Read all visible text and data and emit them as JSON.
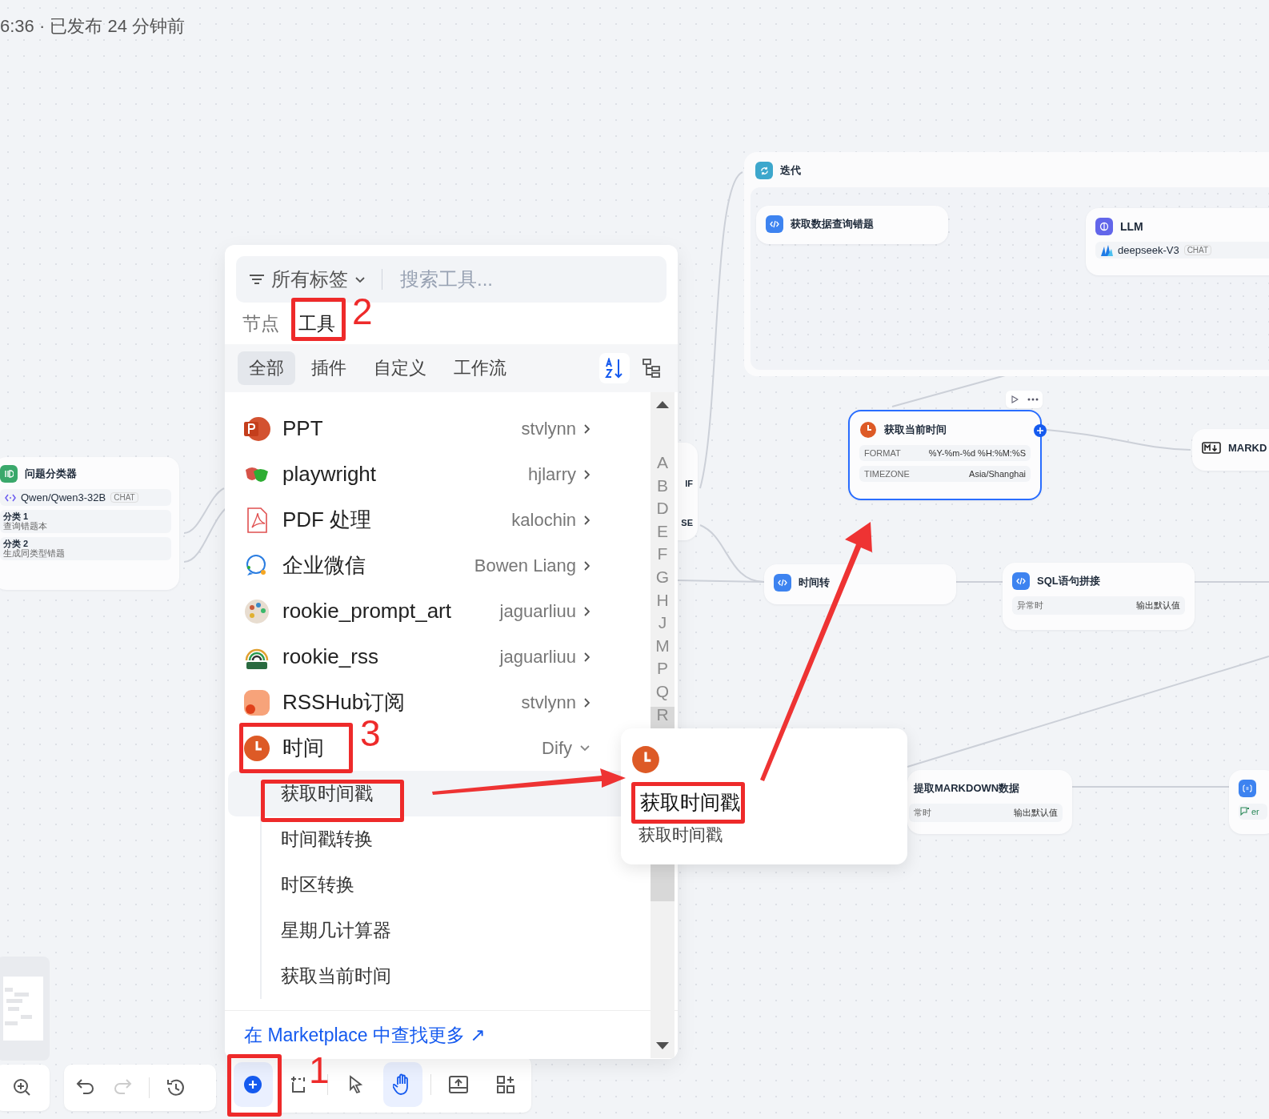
{
  "header": {
    "text": "6:36 · 已发布 24 分钟前"
  },
  "classifier": {
    "title": "问题分类器",
    "model": "Qwen/Qwen3-32B",
    "tag": "CHAT",
    "classes": [
      {
        "label": "分类 1",
        "text": "查询错题本"
      },
      {
        "label": "分类 2",
        "text": "生成同类型错题"
      }
    ]
  },
  "iteration": {
    "title": "迭代",
    "inner": {
      "title": "获取数据查询错题"
    },
    "llm": {
      "title": "LLM",
      "model": "deepseek-V3",
      "tag": "CHAT"
    }
  },
  "if_node": {
    "branches": [
      "IF",
      "SE"
    ]
  },
  "time_node": {
    "title": "获取当前时间",
    "selected": true,
    "params": [
      {
        "key": "FORMAT",
        "value": "%Y-%m-%d %H:%M:%S"
      },
      {
        "key": "TIMEZONE",
        "value": "Asia/Shanghai"
      }
    ]
  },
  "markdown_node": {
    "title": "MARKD"
  },
  "convert_node": {
    "title": "时间转"
  },
  "sql_node": {
    "title": "SQL语句拼接",
    "key": "异常时",
    "value": "输出默认值"
  },
  "extract_node": {
    "title": "提取MARKDOWN数据",
    "key": "常时",
    "value": "输出默认值"
  },
  "var_node": {
    "text": "er"
  },
  "panel": {
    "filter": "所有标签",
    "search_placeholder": "搜索工具...",
    "tabs": [
      {
        "label": "节点",
        "selected": false
      },
      {
        "label": "工具",
        "selected": true
      }
    ],
    "categories": [
      {
        "label": "全部",
        "selected": true
      },
      {
        "label": "插件",
        "selected": false
      },
      {
        "label": "自定义",
        "selected": false
      },
      {
        "label": "工作流",
        "selected": false
      }
    ],
    "tools": [
      {
        "kind": "ppt",
        "name": "PPT",
        "author": "stvlynn",
        "expanded": false
      },
      {
        "kind": "mask",
        "name": "playwright",
        "author": "hjlarry",
        "expanded": false
      },
      {
        "kind": "pdf",
        "name": "PDF 处理",
        "author": "kalochin",
        "expanded": false
      },
      {
        "kind": "chat",
        "name": "企业微信",
        "author": "Bowen Liang",
        "expanded": false
      },
      {
        "kind": "palette",
        "name": "rookie_prompt_art",
        "author": "jaguarliuu",
        "expanded": false
      },
      {
        "kind": "rss",
        "name": "rookie_rss",
        "author": "jaguarliuu",
        "expanded": false
      },
      {
        "kind": "rsshub",
        "name": "RSSHub订阅",
        "author": "stvlynn",
        "expanded": false
      },
      {
        "kind": "clock",
        "name": "时间",
        "author": "Dify",
        "expanded": true,
        "actions": [
          {
            "label": "获取时间戳",
            "selected": true
          },
          {
            "label": "时间戳转换",
            "selected": false
          },
          {
            "label": "时区转换",
            "selected": false
          },
          {
            "label": "星期几计算器",
            "selected": false
          },
          {
            "label": "获取当前时间",
            "selected": false
          }
        ]
      }
    ],
    "index_letters": [
      "A",
      "B",
      "D",
      "E",
      "F",
      "G",
      "H",
      "J",
      "M",
      "P",
      "Q",
      "R"
    ],
    "footer_link": "在 Marketplace 中查找更多 ↗"
  },
  "popover": {
    "title": "获取时间戳",
    "description": "获取时间戳"
  },
  "toolbar": {
    "modes": [
      {
        "kind": "pointer",
        "selected": false
      },
      {
        "kind": "hand",
        "selected": true
      }
    ]
  },
  "annotations": [
    {
      "label": "2"
    },
    {
      "label": "3"
    },
    {
      "label": "1"
    }
  ]
}
